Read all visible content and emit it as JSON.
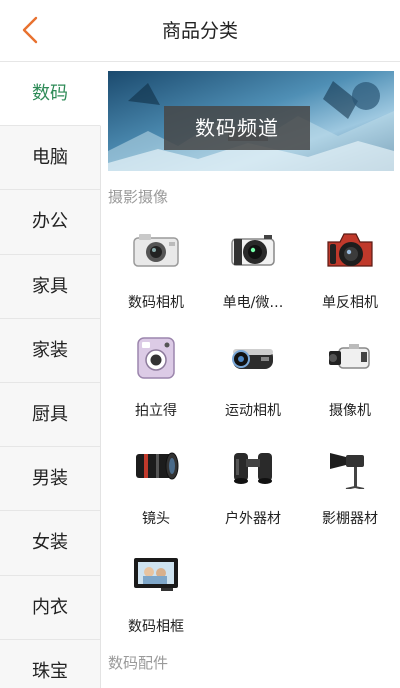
{
  "header": {
    "title": "商品分类",
    "back_icon": "chevron-left-icon",
    "accent": "#e8712f"
  },
  "sidebar": {
    "active_color": "#2e8b57",
    "items": [
      {
        "label": "数码"
      },
      {
        "label": "电脑"
      },
      {
        "label": "办公"
      },
      {
        "label": "家具"
      },
      {
        "label": "家装"
      },
      {
        "label": "厨具"
      },
      {
        "label": "男装"
      },
      {
        "label": "女装"
      },
      {
        "label": "内衣"
      },
      {
        "label": "珠宝"
      }
    ]
  },
  "banner": {
    "text": "数码频道"
  },
  "sections": [
    {
      "title": "摄影摄像",
      "items": [
        {
          "label": "数码相机",
          "icon": "compact-camera-icon"
        },
        {
          "label": "单电/微…",
          "icon": "mirrorless-camera-icon"
        },
        {
          "label": "单反相机",
          "icon": "dslr-camera-icon"
        },
        {
          "label": "拍立得",
          "icon": "instant-camera-icon"
        },
        {
          "label": "运动相机",
          "icon": "action-camera-icon"
        },
        {
          "label": "摄像机",
          "icon": "camcorder-icon"
        },
        {
          "label": "镜头",
          "icon": "lens-icon"
        },
        {
          "label": "户外器材",
          "icon": "binoculars-icon"
        },
        {
          "label": "影棚器材",
          "icon": "studio-light-icon"
        },
        {
          "label": "数码相框",
          "icon": "photo-frame-icon"
        }
      ]
    },
    {
      "title": "数码配件"
    }
  ]
}
